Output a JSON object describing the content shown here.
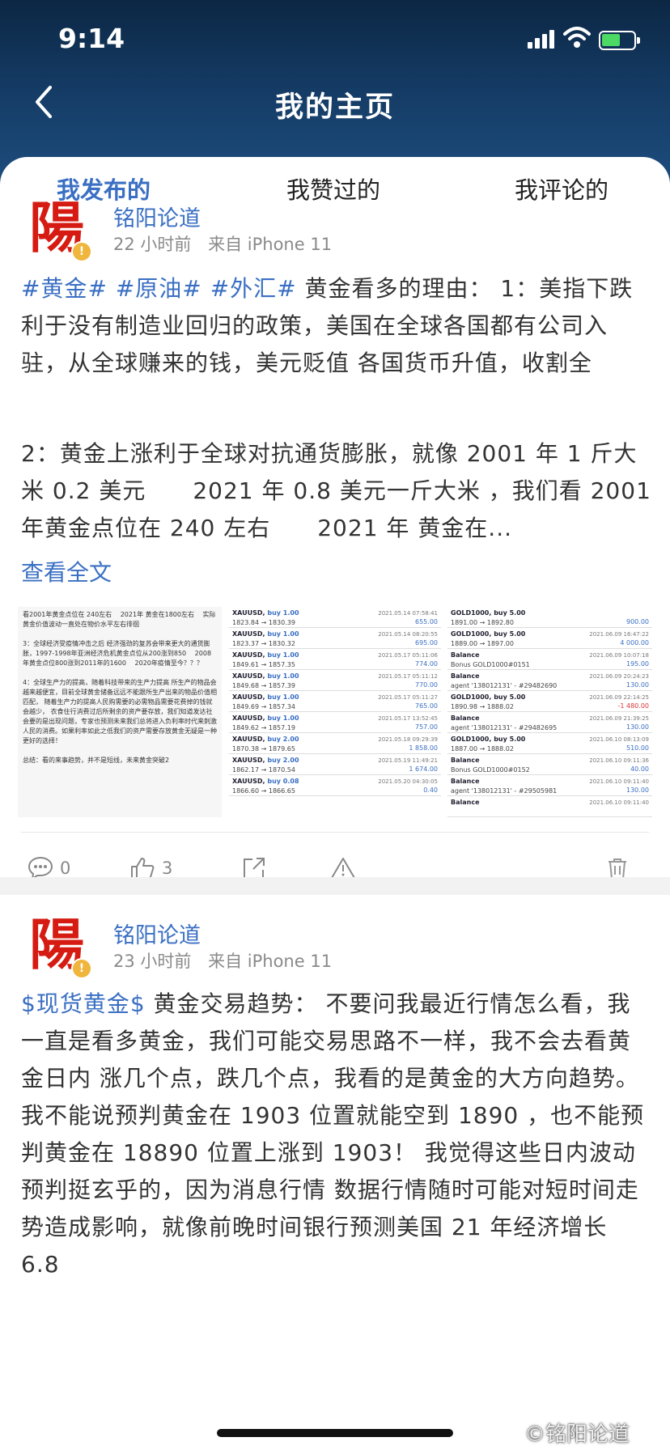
{
  "status": {
    "time": "9:14"
  },
  "nav": {
    "title": "我的主页"
  },
  "tabs": [
    {
      "label": "我发布的"
    },
    {
      "label": "我赞过的"
    },
    {
      "label": "我评论的"
    }
  ],
  "posts": [
    {
      "author": "铭阳论道",
      "avatar_char": "陽",
      "time_ago": "22 小时前",
      "source": "来自 iPhone 11",
      "topics": [
        "#黄金#",
        "#原油#",
        "#外汇#"
      ],
      "text_line1": " 黄金看多的理由： 1：美指下",
      "text_rest": "跌利于没有制造业回归的政策，美国在全球各国都有公司入驻，从全球赚来的钱，美元贬值 各国货币升值，收割全球！！！",
      "text_para2": "2：黄金上涨利于全球对抗通货膨胀，就像 2001 年 1 斤大米 0.2 美元　　2021 年 0.8 美元一斤大米 ，我们看 2001 年黄金点位在 240 左右　　2021 年 黄金在...",
      "more": "查看全文",
      "thumb1_text": "看2001年黄金点位在 240左右　 2021年 黄金在1800左右　 实际黄金价值波动一直处在物价水平左右徘徊\n\n3：全球经济受疫情冲击之后 经济强劲的复苏会带来更大的通货膨胀，1997-1998年亚洲经济危机黄金点位从200涨到850　 2008年黄金点位800涨到2011年的1600　 2020年疫情至今？？？\n\n4：全球生产力的提高，随着科技带来的生产力提高 所生产的物品会越来越便宜，目前全球黄金储备远远不能跟所生产出来的物品价值相匹配， 随着生产力的提高人民购需要的必需物品需要花费掉的钱就会越少， 衣食住行消费过后所剩余的资产要存放，我们知道发达社会要的是出现问题，专家也预测未来我们总将进入负利率时代来刺激人民的消费。如果利率如此之低我们的资产需要存放黄金无疑是一种更好的选择！\n\n总结：看的来事趋势，并不是短线，未来黄金突破2",
      "thumb2_rows": [
        {
          "sym": "XAUUSD,",
          "buy": "buy 1.00",
          "price": "1823.84 → 1830.39",
          "date": "2021.05.14 07:58:41",
          "profit": "655.00"
        },
        {
          "sym": "XAUUSD,",
          "buy": "buy 1.00",
          "price": "1823.37 → 1830.32",
          "date": "2021.05.14 08:20:55",
          "profit": "695.00"
        },
        {
          "sym": "XAUUSD,",
          "buy": "buy 1.00",
          "price": "1849.61 → 1857.35",
          "date": "2021.05.17 05:11:06",
          "profit": "774.00"
        },
        {
          "sym": "XAUUSD,",
          "buy": "buy 1.00",
          "price": "1849.68 → 1857.39",
          "date": "2021.05.17 05:11:12",
          "profit": "770.00"
        },
        {
          "sym": "XAUUSD,",
          "buy": "buy 1.00",
          "price": "1849.69 → 1857.34",
          "date": "2021.05.17 05:11:27",
          "profit": "765.00"
        },
        {
          "sym": "XAUUSD,",
          "buy": "buy 1.00",
          "price": "1849.62 → 1857.19",
          "date": "2021.05.17 13:52:45",
          "profit": "757.00"
        },
        {
          "sym": "XAUUSD,",
          "buy": "buy 2.00",
          "price": "1870.38 → 1879.65",
          "date": "2021.05.18 09:29:39",
          "profit": "1 858.00"
        },
        {
          "sym": "XAUUSD,",
          "buy": "buy 2.00",
          "price": "1862.17 → 1870.54",
          "date": "2021.05.19 11:49:21",
          "profit": "1 674.00"
        },
        {
          "sym": "XAUUSD,",
          "buy": "buy 0.08",
          "price": "1866.60 → 1866.65",
          "date": "2021.05.20 04:30:05",
          "profit": "0.40"
        }
      ],
      "thumb3_rows": [
        {
          "l1": "GOLD1000, buy 5.00",
          "l2": "1891.00 → 1892.80",
          "date": "",
          "profit": "900.00",
          "neg": false
        },
        {
          "l1": "GOLD1000, buy 5.00",
          "l2": "1889.00 → 1897.00",
          "date": "2021.06.09 16:47:22",
          "profit": "4 000.00",
          "neg": false
        },
        {
          "l1": "Balance",
          "l2": "Bonus GOLD1000#0151",
          "date": "2021.06.09 10:07:18",
          "profit": "195.00",
          "neg": false
        },
        {
          "l1": "Balance",
          "l2": "agent '138012131' - #29482690",
          "date": "2021.06.09 20:24:23",
          "profit": "130.00",
          "neg": false
        },
        {
          "l1": "GOLD1000, buy 5.00",
          "l2": "1890.98 → 1888.02",
          "date": "2021.06.09 22:14:25",
          "profit": "-1 480.00",
          "neg": true
        },
        {
          "l1": "Balance",
          "l2": "agent '138012131' - #29482695",
          "date": "2021.06.09 21:39:25",
          "profit": "130.00",
          "neg": false
        },
        {
          "l1": "GOLD1000, buy 5.00",
          "l2": "1887.00 → 1888.02",
          "date": "2021.06.10 08:13:09",
          "profit": "510.00",
          "neg": false
        },
        {
          "l1": "Balance",
          "l2": "Bonus GOLD1000#0152",
          "date": "2021.06.10 09:11:36",
          "profit": "40.00",
          "neg": false
        },
        {
          "l1": "Balance",
          "l2": "agent '138012131' - #29505981",
          "date": "2021.06.10 09:11:40",
          "profit": "130.00",
          "neg": false
        },
        {
          "l1": "Balance",
          "l2": "",
          "date": "2021.06.10 09:11:40",
          "profit": "",
          "neg": false
        }
      ],
      "comments": "0",
      "likes": "3"
    },
    {
      "author": "铭阳论道",
      "avatar_char": "陽",
      "time_ago": "23 小时前",
      "source": "来自 iPhone 11",
      "topic": "$现货黄金$",
      "text_line1": " 黄金交易趋势： 不要问我最近行情怎么",
      "text_rest": "看，我一直是看多黄金，我们可能交易思路不一样，我不会去看黄金日内 涨几个点，跌几个点，我看的是黄金的大方向趋势。 我不能说预判黄金在 1903 位置就能空到 1890 ，也不能预判黄金在 18890 位置上涨到 1903！ 我觉得这些日内波动预判挺玄乎的，因为消息行情 数据行情随时可能对短时间走势造成影响，就像前晚时间银行预测美国 21 年经济增长 6.8"
    }
  ],
  "watermark": "©铭阳论道"
}
